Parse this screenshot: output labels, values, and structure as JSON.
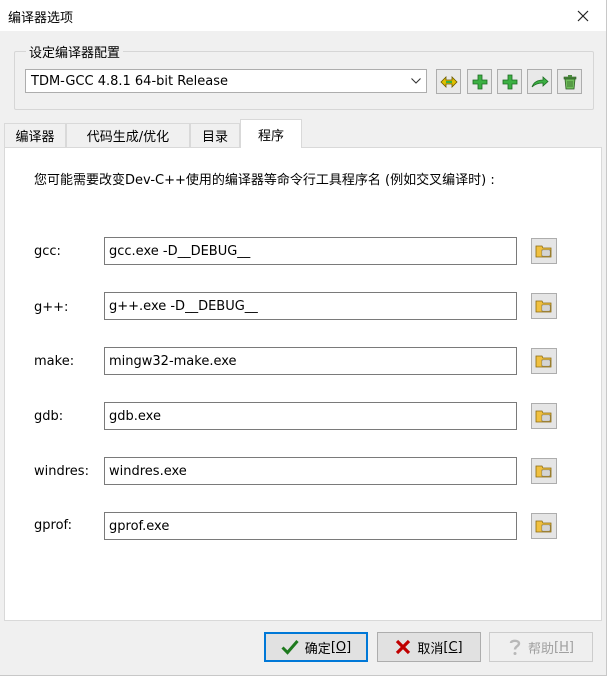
{
  "window": {
    "title": "编译器选项"
  },
  "config_group": {
    "legend": "设定编译器配置",
    "selected_config": "TDM-GCC 4.8.1 64-bit Release",
    "toolbar_icons": [
      "rename-config-icon",
      "add-config-icon",
      "add-config-alt-icon",
      "import-config-icon",
      "delete-config-icon"
    ]
  },
  "tabs": [
    {
      "label": "编译器",
      "active": false
    },
    {
      "label": "代码生成/优化",
      "active": false
    },
    {
      "label": "目录",
      "active": false
    },
    {
      "label": "程序",
      "active": true
    }
  ],
  "programs": {
    "description": "您可能需要改变Dev-C++使用的编译器等命令行工具程序名 (例如交叉编译时) :",
    "rows": [
      {
        "label": "gcc:",
        "value": "gcc.exe -D__DEBUG__"
      },
      {
        "label": "g++:",
        "value": "g++.exe -D__DEBUG__"
      },
      {
        "label": "make:",
        "value": "mingw32-make.exe"
      },
      {
        "label": "gdb:",
        "value": "gdb.exe"
      },
      {
        "label": "windres:",
        "value": "windres.exe"
      },
      {
        "label": "gprof:",
        "value": "gprof.exe"
      }
    ]
  },
  "buttons": {
    "ok": {
      "label": "确定",
      "hotkey": "[O]"
    },
    "cancel": {
      "label": "取消",
      "hotkey": "[C]"
    },
    "help": {
      "label": "帮助",
      "hotkey": "[H]",
      "enabled": false
    }
  },
  "colors": {
    "accent": "#0078d7",
    "add_icon_green": "#3cb043",
    "cancel_red": "#c00000"
  }
}
